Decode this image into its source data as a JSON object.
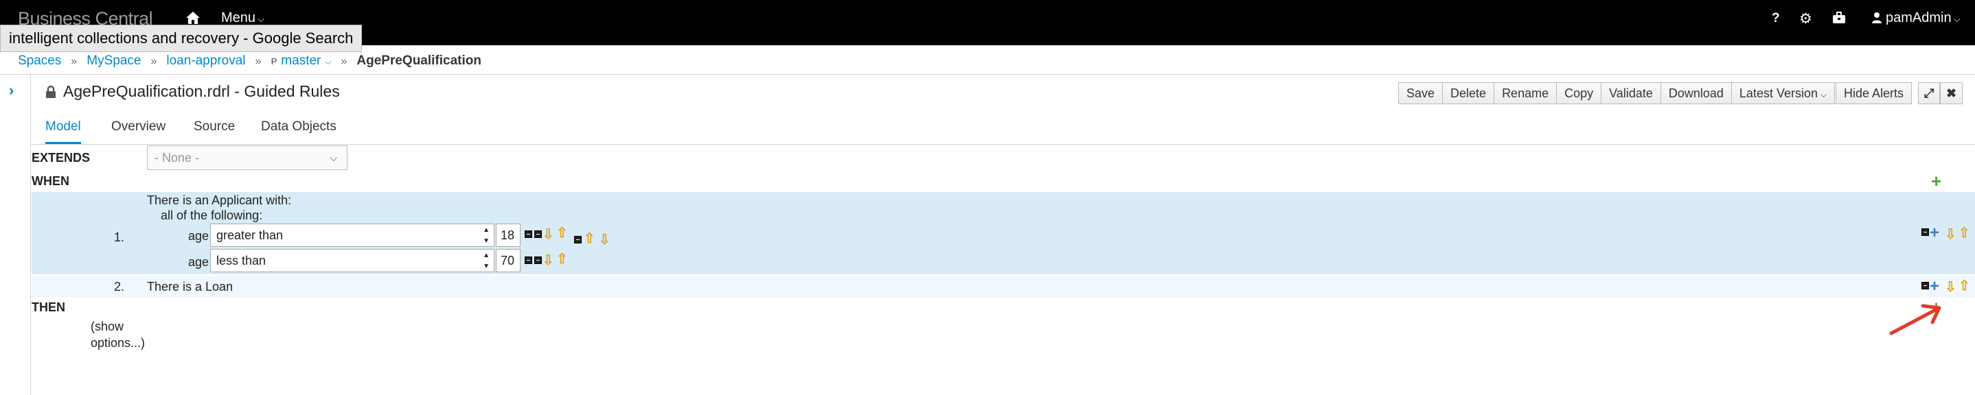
{
  "navbar": {
    "brand": "Business Central",
    "menu_label": "Menu",
    "help_label": "?",
    "user_label": "pamAdmin"
  },
  "tooltip": "intelligent collections and recovery - Google Search",
  "breadcrumb": {
    "items": [
      "Spaces",
      "MySpace",
      "loan-approval",
      "master"
    ],
    "current": "AgePreQualification"
  },
  "editor": {
    "title": "AgePreQualification.rdrl - Guided Rules",
    "buttons": [
      "Save",
      "Delete",
      "Rename",
      "Copy",
      "Validate",
      "Download",
      "Latest Version"
    ],
    "hide_alerts": "Hide Alerts"
  },
  "tabs": [
    "Model",
    "Overview",
    "Source",
    "Data Objects"
  ],
  "rule": {
    "extends_label": "EXTENDS",
    "extends_value": "- None -",
    "when_label": "WHEN",
    "then_label": "THEN",
    "pattern1": {
      "number": "1.",
      "header": "There is an Applicant with:",
      "subheader": "all of the following:",
      "constraints": [
        {
          "field": "age",
          "operator": "greater than",
          "value": "18"
        },
        {
          "field": "age",
          "operator": "less than",
          "value": "70"
        }
      ]
    },
    "pattern2": {
      "number": "2.",
      "text": "There is a Loan"
    },
    "show_options_line1": "(show",
    "show_options_line2": "options...)"
  },
  "colors": {
    "accent": "#0088ce",
    "pattern_bg": "#d8ebf7",
    "add_green": "#55a532",
    "arrow_orange": "#e8a317",
    "annotation_red": "#e03c2c"
  }
}
